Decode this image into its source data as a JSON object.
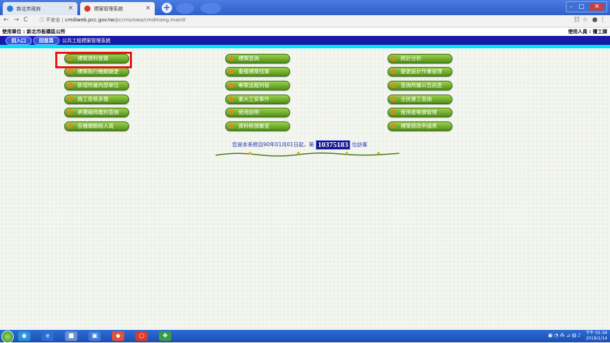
{
  "browser": {
    "tabs": [
      {
        "label": "新北市政府",
        "favicon_color": "#2a7ad8",
        "active": false
      },
      {
        "label": "標案管理系統",
        "favicon_color": "#d83a2a",
        "active": true
      }
    ],
    "new_tab": "+",
    "close_glyph": "×",
    "window_controls": [
      "–",
      "□",
      "✕"
    ],
    "nav": {
      "back": "←",
      "forward": "→",
      "reload": "C",
      "info": "ⓘ"
    },
    "security_label": "不安全",
    "url_host": "cmdiweb.pcc.gov.tw",
    "url_path": "/pccms/owa/cmdmang.main0",
    "right_icons": [
      "☷",
      "☆",
      "●",
      "⋮"
    ]
  },
  "header": {
    "unit_label": "使用單位 : 新北市板橋區公所",
    "user_label": "使用人員 : 覆工課",
    "sys_buttons": [
      "回入口",
      "回首頁"
    ],
    "system_title": "公共工程標案管理系統"
  },
  "menu": {
    "column1": [
      "標案資料登錄",
      "標案執行機關變更",
      "新增所屬內部單位",
      "施工查核多報",
      "承攬廠商履約查詢",
      "各機關聯絡人員"
    ],
    "column2": [
      "標案查詢",
      "重複標案找案",
      "專案追蹤列管",
      "重大工安事件",
      "使用說明",
      "資料帳號審查"
    ],
    "column3": [
      "統計分析",
      "變更設計作業管理",
      "查詢所屬公告訊息",
      "全民督工查詢",
      "使用者帳號管理",
      "標案修改申請表"
    ]
  },
  "counter": {
    "prefix": "您是本系統自90年01月01日起，第",
    "number": "10375183",
    "suffix": "位訪客"
  },
  "taskbar": {
    "apps": [
      "◉",
      "e",
      "■",
      "▣",
      "◆",
      "○",
      "❖"
    ],
    "app_colors": [
      "#2c8fd8",
      "#2b6fd0",
      "#6a8fcf",
      "#3d7bd6",
      "#e0503a",
      "#d9392e",
      "#3a9a4a"
    ],
    "tray_icons": "▣ ◔ ⁂ ⊿ ▤ ♪",
    "time": "下午 01:34",
    "date": "2019/1/14"
  },
  "colors": {
    "accent_blue": "#1a1aa8",
    "menu_green": "#5c9e1f",
    "highlight_red": "#ee1111",
    "cyan": "#00e4f4"
  }
}
